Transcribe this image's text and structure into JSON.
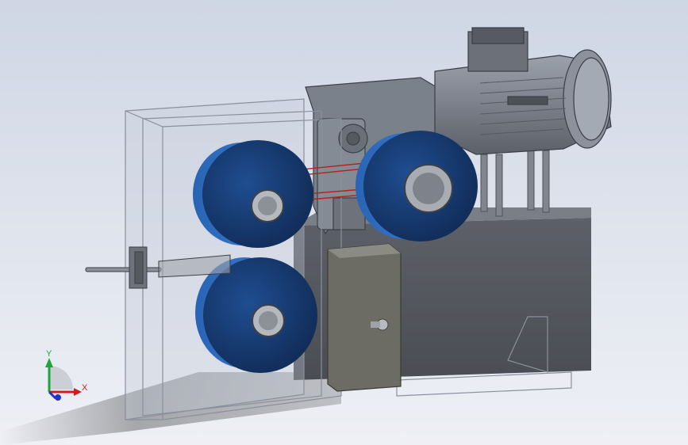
{
  "viewport": {
    "background_top": "#cfd6e4",
    "background_bottom": "#eef0f5"
  },
  "colors": {
    "roller_blue": "#2f6fc1",
    "roller_dark": "#1b3f74",
    "steel": "#6f7680",
    "glass_edge": "#8a909b",
    "wire_red": "#b0261f"
  },
  "triad": {
    "x_label": "X",
    "y_label": "Y",
    "x_color": "#d01c1c",
    "y_color": "#1fa53a",
    "z_color": "#2233cc"
  }
}
